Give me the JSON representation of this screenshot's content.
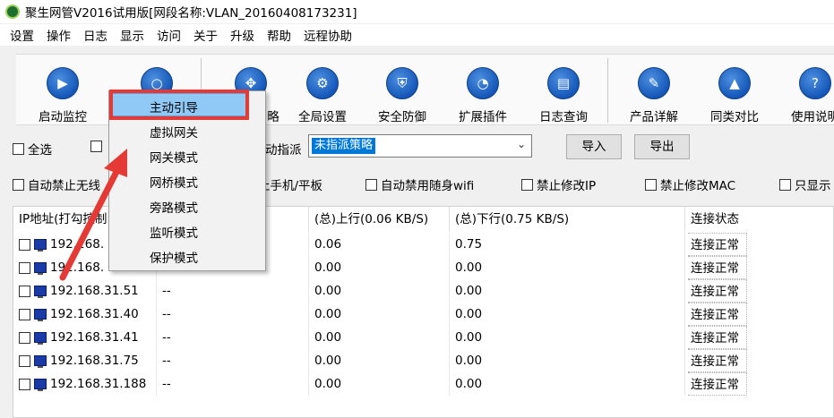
{
  "window": {
    "title": "聚生网管V2016试用版[网段名称:VLAN_20160408173231]"
  },
  "menu": [
    "设置",
    "操作",
    "日志",
    "显示",
    "访问",
    "关于",
    "升级",
    "帮助",
    "远程协助"
  ],
  "toolbar": {
    "items": [
      {
        "label": "启动监控",
        "icon": "play-icon"
      },
      {
        "label": "",
        "icon": "search-icon"
      },
      {
        "label": "略",
        "icon": "network-icon"
      },
      {
        "label": "全局设置",
        "icon": "gear-icon"
      },
      {
        "label": "安全防御",
        "icon": "shield-icon"
      },
      {
        "label": "扩展插件",
        "icon": "pie-chart-icon"
      },
      {
        "label": "日志查询",
        "icon": "log-book-icon"
      },
      {
        "label": "产品详解",
        "icon": "edit-icon"
      },
      {
        "label": "同类对比",
        "icon": "graduation-cap-icon"
      },
      {
        "label": "使用说明",
        "icon": "help-icon"
      }
    ]
  },
  "controls": {
    "select_all": "全选",
    "assign_label": "动指派",
    "policy_value": "未指派策略",
    "import": "导入",
    "export": "导出"
  },
  "options": [
    "自动禁止无线",
    "止手机/平板",
    "自动禁用随身wifi",
    "禁止修改IP",
    "禁止修改MAC",
    "只显示"
  ],
  "table": {
    "headers": [
      "IP地址(打勾控制",
      "",
      "(总)上行(0.06 KB/S)",
      "(总)下行(0.75 KB/S)",
      "连接状态"
    ],
    "rows": [
      {
        "ip": "192.168.",
        "name": "",
        "up": "0.06",
        "down": "0.75",
        "status": "连接正常"
      },
      {
        "ip": "192.168.",
        "name": "",
        "up": "0.00",
        "down": "0.00",
        "status": "连接正常"
      },
      {
        "ip": "192.168.31.51",
        "name": "--",
        "up": "0.00",
        "down": "0.00",
        "status": "连接正常"
      },
      {
        "ip": "192.168.31.40",
        "name": "--",
        "up": "0.00",
        "down": "0.00",
        "status": "连接正常"
      },
      {
        "ip": "192.168.31.41",
        "name": "--",
        "up": "0.00",
        "down": "0.00",
        "status": "连接正常"
      },
      {
        "ip": "192.168.31.75",
        "name": "--",
        "up": "0.00",
        "down": "0.00",
        "status": "连接正常"
      },
      {
        "ip": "192.168.31.188",
        "name": "--",
        "up": "0.00",
        "down": "0.00",
        "status": "连接正常"
      }
    ]
  },
  "popup_menu": {
    "items": [
      "主动引导",
      "虚拟网关",
      "网关模式",
      "网桥模式",
      "旁路模式",
      "监听模式",
      "保护模式"
    ],
    "selected_index": 0
  },
  "colors": {
    "highlight": "#e53935",
    "selection": "#90c8f6",
    "accent": "#0078d7"
  }
}
